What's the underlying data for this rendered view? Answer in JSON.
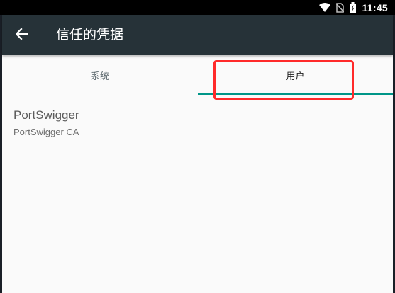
{
  "status_bar": {
    "time": "11:45",
    "icons": [
      "wifi-icon",
      "no-sim-icon",
      "battery-icon"
    ]
  },
  "app_bar": {
    "back_icon": "arrow-back-icon",
    "title": "信任的凭据"
  },
  "tabs": [
    {
      "label": "系统",
      "selected": false
    },
    {
      "label": "用户",
      "selected": true
    }
  ],
  "colors": {
    "app_bar": "#263238",
    "tab_indicator": "#009688",
    "highlight": "#ff2a2a",
    "background": "#fafafa"
  },
  "certificates": [
    {
      "title": "PortSwigger",
      "subtitle": "PortSwigger CA"
    }
  ]
}
